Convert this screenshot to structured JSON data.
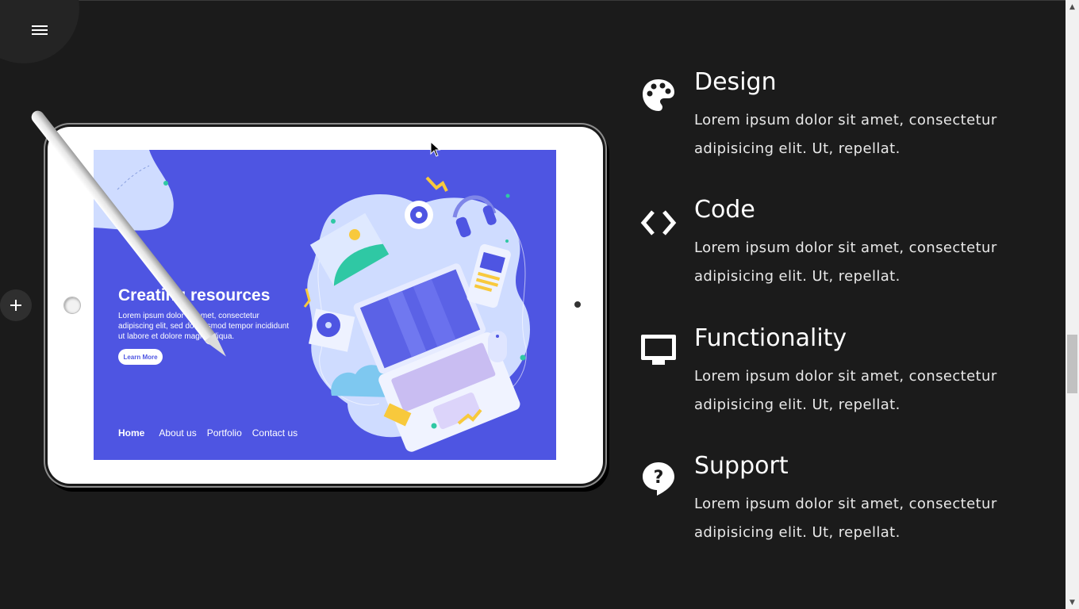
{
  "nav": {
    "menu_icon": "hamburger-icon",
    "add_icon": "plus-icon"
  },
  "mockup": {
    "hero_title": "Creating resources",
    "hero_body": "Lorem ipsum dolor sit amet, consectetur adipiscing elit, sed do eiusmod tempor incididunt ut labore et dolore magna aliqua.",
    "cta_label": "Learn More",
    "nav_links": [
      "Home",
      "About us",
      "Portfolio",
      "Contact us"
    ],
    "screen_color": "#4e55e2"
  },
  "features": [
    {
      "icon": "palette-icon",
      "title": "Design",
      "text": "Lorem ipsum dolor sit amet, consectetur adipisicing elit. Ut, repellat."
    },
    {
      "icon": "code-icon",
      "title": "Code",
      "text": "Lorem ipsum dolor sit amet, consectetur adipisicing elit. Ut, repellat."
    },
    {
      "icon": "monitor-icon",
      "title": "Functionality",
      "text": "Lorem ipsum dolor sit amet, consectetur adipisicing elit. Ut, repellat."
    },
    {
      "icon": "question-icon",
      "title": "Support",
      "text": "Lorem ipsum dolor sit amet, consectetur adipisicing elit. Ut, repellat."
    }
  ],
  "theme": {
    "background": "#1b1b1b",
    "text": "#ffffff"
  }
}
